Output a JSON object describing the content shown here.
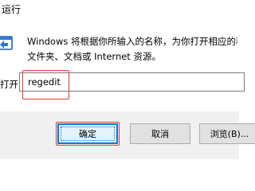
{
  "window": {
    "title": "运行",
    "description_line1": "Windows 将根据你所输入的名称，为你打开相应的程序、",
    "description_line2": "文件夹、文档或 Internet 资源。"
  },
  "open_field": {
    "label": "打开(O):",
    "value": "regedit"
  },
  "buttons": {
    "ok": "确定",
    "cancel": "取消",
    "browse": "浏览(B)..."
  },
  "icons": {
    "run": "run-dialog-icon"
  },
  "colors": {
    "highlight": "#e03a3a",
    "default_button_border": "#0078d7"
  }
}
